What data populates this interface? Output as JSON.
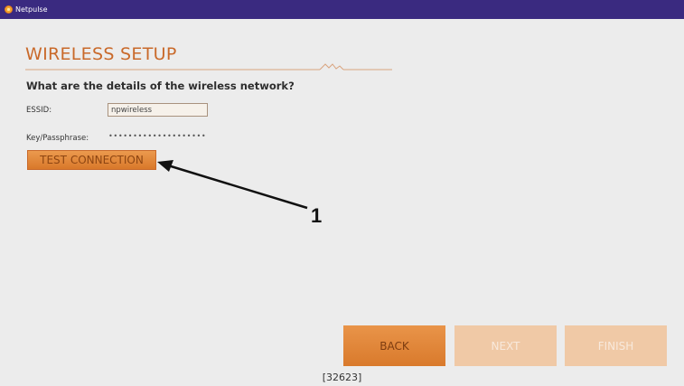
{
  "app": {
    "name": "Netpulse"
  },
  "page": {
    "title": "WIRELESS SETUP",
    "question": "What are the details of the wireless network?"
  },
  "fields": {
    "essid_label": "ESSID:",
    "essid_value": "npwireless",
    "pass_label": "Key/Passphrase:",
    "pass_masked": "••••••••••••••••••••"
  },
  "test_button_label": "TEST CONNECTION",
  "annotation": {
    "label": "1"
  },
  "nav": {
    "back": "BACK",
    "next": "NEXT",
    "finish": "FINISH"
  },
  "footer": {
    "build": "[32623]"
  },
  "colors": {
    "titlebar": "#3a2a80",
    "accent": "#c9692a",
    "button_active": "#e0843a",
    "button_disabled": "#f0c9a6",
    "background": "#ececec"
  },
  "icons": {
    "logo": "netpulse-logo-icon"
  }
}
